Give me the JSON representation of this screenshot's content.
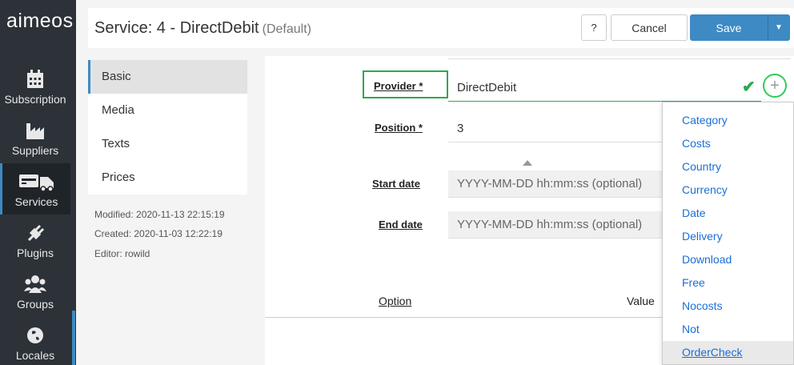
{
  "app": {
    "logo": "aimeos"
  },
  "nav": [
    {
      "label": "Subscription",
      "icon": "calendar-icon"
    },
    {
      "label": "Suppliers",
      "icon": "factory-icon"
    },
    {
      "label": "Services",
      "icon": "truck-icon",
      "active": true
    },
    {
      "label": "Plugins",
      "icon": "plug-icon"
    },
    {
      "label": "Groups",
      "icon": "users-icon"
    },
    {
      "label": "Locales",
      "icon": "globe-icon"
    }
  ],
  "header": {
    "title": "Service: 4 - DirectDebit",
    "subtitle": "(Default)",
    "help_label": "?",
    "cancel_label": "Cancel",
    "save_label": "Save"
  },
  "subnav": [
    {
      "label": "Basic",
      "active": true
    },
    {
      "label": "Media"
    },
    {
      "label": "Texts"
    },
    {
      "label": "Prices"
    }
  ],
  "meta": {
    "modified": "Modified: 2020-11-13 22:15:19",
    "created": "Created: 2020-11-03 12:22:19",
    "editor": "Editor: rowild"
  },
  "form": {
    "provider_label": "Provider *",
    "provider_value": "DirectDebit",
    "position_label": "Position *",
    "position_value": "3",
    "start_label": "Start date",
    "start_placeholder": "YYYY-MM-DD hh:mm:ss (optional)",
    "end_label": "End date",
    "end_placeholder": "YYYY-MM-DD hh:mm:ss (optional)"
  },
  "table": {
    "col_option": "Option",
    "col_value": "Value"
  },
  "dropdown": [
    "Category",
    "Costs",
    "Country",
    "Currency",
    "Date",
    "Delivery",
    "Download",
    "Free",
    "Nocosts",
    "Not",
    "OrderCheck"
  ],
  "colors": {
    "accent": "#3d8ac4",
    "success": "#2ea84f",
    "link": "#1a6ed8",
    "nav_bg": "#2c3238"
  }
}
